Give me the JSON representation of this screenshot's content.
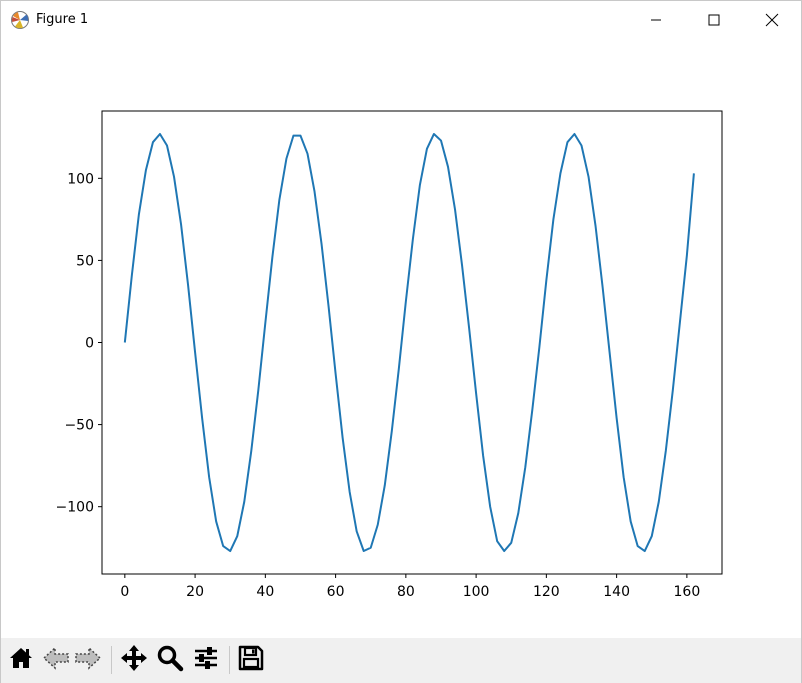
{
  "window": {
    "title": "Figure 1",
    "app_icon": "matplotlib-icon",
    "controls": [
      "minimize-icon",
      "maximize-icon",
      "close-icon"
    ]
  },
  "toolbar": {
    "tools": [
      {
        "name": "home-icon"
      },
      {
        "name": "back-icon"
      },
      {
        "name": "forward-icon"
      },
      {
        "name": "pan-icon"
      },
      {
        "name": "zoom-icon"
      },
      {
        "name": "configure-subplots-icon"
      },
      {
        "name": "save-icon"
      }
    ]
  },
  "colors": {
    "line": "#1f77b4",
    "toolbar_bg": "#f0f0f0"
  },
  "chart_data": {
    "type": "line",
    "title": "",
    "xlabel": "",
    "ylabel": "",
    "grid": false,
    "xlim": [
      -6.5,
      170
    ],
    "ylim": [
      -141,
      141
    ],
    "xticks": [
      0,
      20,
      40,
      60,
      80,
      100,
      120,
      140,
      160
    ],
    "yticks": [
      -100,
      -50,
      0,
      50,
      100
    ],
    "xtick_labels": [
      "0",
      "20",
      "40",
      "60",
      "80",
      "100",
      "120",
      "140",
      "160"
    ],
    "ytick_labels": [
      "−100",
      "−50",
      "0",
      "50",
      "100"
    ],
    "series": [
      {
        "values_description": "sinusoid sampled at integer x",
        "x": [
          0,
          2,
          4,
          6,
          8,
          10,
          12,
          14,
          16,
          18,
          20,
          22,
          24,
          26,
          28,
          30,
          32,
          34,
          36,
          38,
          40,
          42,
          44,
          46,
          48,
          50,
          52,
          54,
          56,
          58,
          60,
          62,
          64,
          66,
          68,
          70,
          72,
          74,
          76,
          78,
          80,
          82,
          84,
          86,
          88,
          90,
          92,
          94,
          96,
          98,
          100,
          102,
          104,
          106,
          108,
          110,
          112,
          114,
          116,
          118,
          120,
          122,
          124,
          126,
          128,
          130,
          132,
          134,
          136,
          138,
          140,
          142,
          144,
          146,
          148,
          150,
          152,
          154,
          156,
          158,
          160,
          162
        ],
        "y": [
          0,
          41,
          78,
          105,
          122,
          127,
          120,
          101,
          72,
          35,
          -6,
          -46,
          -82,
          -109,
          -124,
          -127,
          -118,
          -97,
          -66,
          -29,
          12,
          52,
          87,
          112,
          126,
          126,
          115,
          92,
          60,
          22,
          -19,
          -58,
          -91,
          -115,
          -127,
          -125,
          -111,
          -87,
          -54,
          -16,
          25,
          63,
          96,
          118,
          127,
          123,
          107,
          81,
          47,
          9,
          -31,
          -69,
          -100,
          -121,
          -127,
          -122,
          -104,
          -76,
          -41,
          -3,
          38,
          75,
          103,
          122,
          127,
          120,
          101,
          71,
          34,
          -6,
          -46,
          -82,
          -109,
          -124,
          -127,
          -118,
          -97,
          -66,
          -29,
          12,
          53,
          103
        ]
      }
    ]
  }
}
